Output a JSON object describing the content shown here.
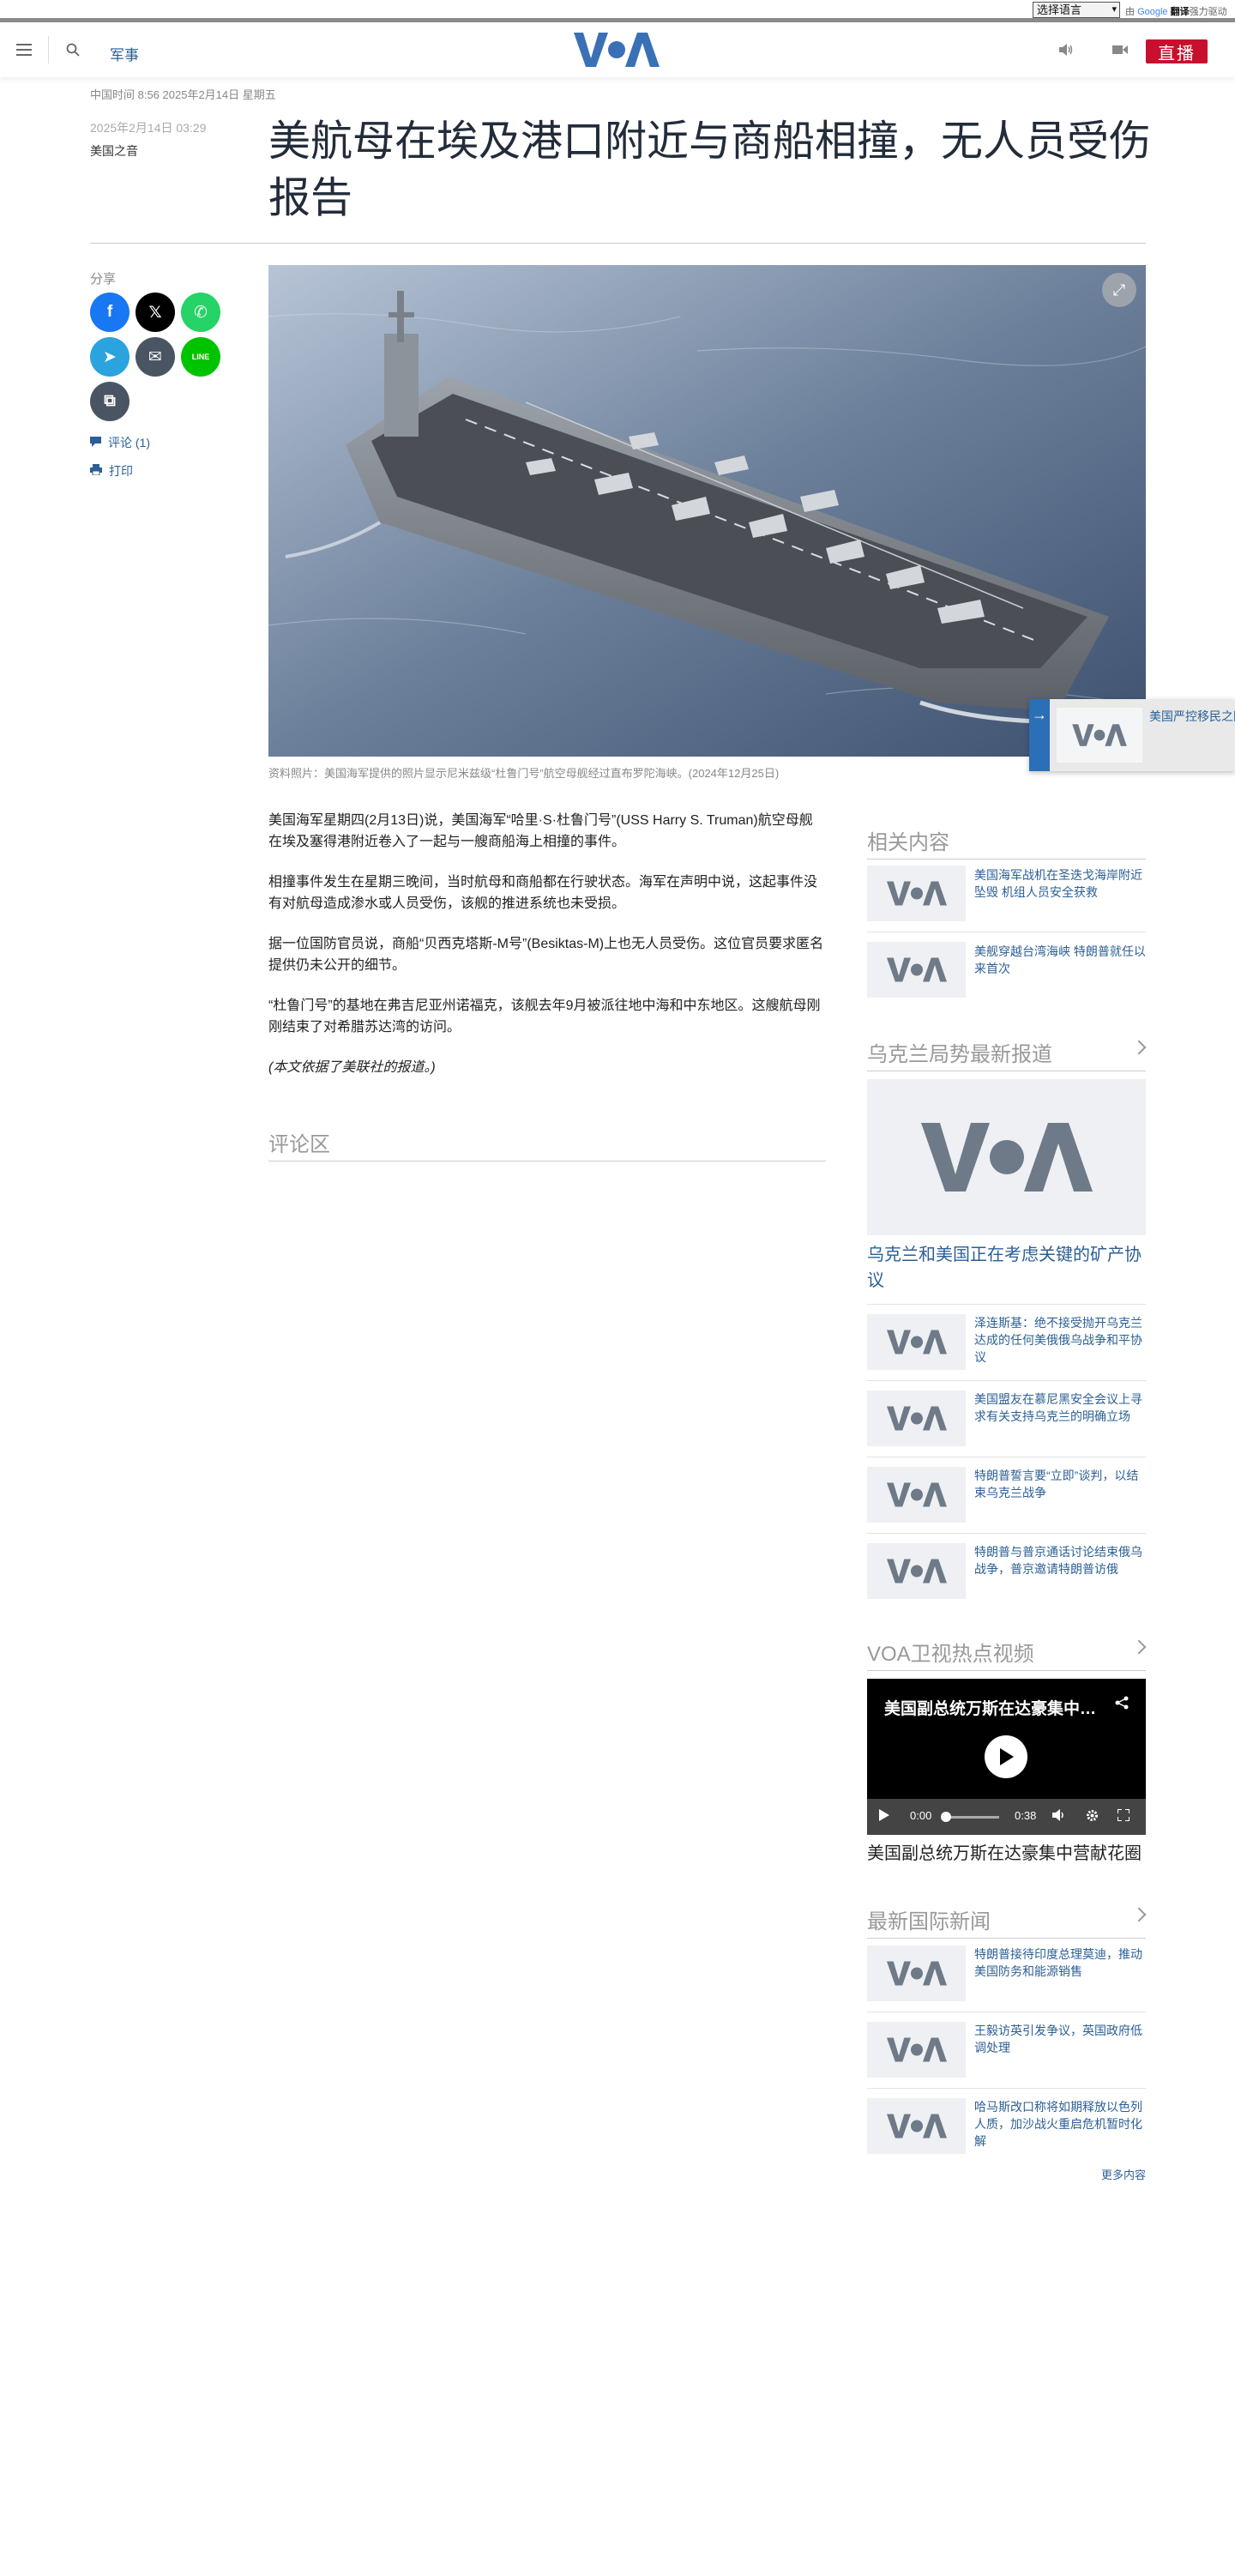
{
  "translate_bar": {
    "select_label": "选择语言",
    "powered_prefix": "由",
    "google": "Google",
    "translate_word": "翻译",
    "powered_suffix": "强力驱动"
  },
  "header": {
    "section": "军事",
    "logo_alt": "VOA",
    "live_label": "直播",
    "icons": [
      "menu-icon",
      "search-icon",
      "audio-icon",
      "video-icon"
    ]
  },
  "article": {
    "dateline": "中国时间 8:56 2025年2月14日 星期五",
    "published": "2025年2月14日 03:29",
    "byline": "美国之音",
    "title": "美航母在埃及港口附近与商船相撞，无人员受伤报告",
    "image_caption": "资料照片：美国海军提供的照片显示尼米兹级“杜鲁门号”航空母舰经过直布罗陀海峡。(2024年12月25日)",
    "paragraphs": [
      "美国海军星期四(2月13日)说，美国海军“哈里·S·杜鲁门号”(USS Harry S. Truman)航空母舰在埃及塞得港附近卷入了一起与一艘商船海上相撞的事件。",
      "相撞事件发生在星期三晚间，当时航母和商船都在行驶状态。海军在声明中说，这起事件没有对航母造成渗水或人员受伤，该舰的推进系统也未受损。",
      "据一位国防官员说，商船“贝西克塔斯-M号”(Besiktas-M)上也无人员受伤。这位官员要求匿名提供仍未公开的细节。",
      "“杜鲁门号”的基地在弗吉尼亚州诺福克，该舰去年9月被派往地中海和中东地区。这艘航母刚刚结束了对希腊苏达湾的访问。"
    ],
    "note": "(本文依据了美联社的报道。)",
    "comments_heading": "评论区"
  },
  "share": {
    "label": "分享",
    "buttons": [
      {
        "name": "facebook-share-button",
        "glyph": "f",
        "color": "#1877f2"
      },
      {
        "name": "x-share-button",
        "glyph": "𝕏",
        "color": "#000000"
      },
      {
        "name": "whatsapp-share-button",
        "glyph": "✆",
        "color": "#25d366"
      },
      {
        "name": "telegram-share-button",
        "glyph": "➤",
        "color": "#2aa3df"
      },
      {
        "name": "email-share-button",
        "glyph": "✉",
        "color": "#4a5563"
      },
      {
        "name": "line-share-button",
        "glyph": "LINE",
        "color": "#00c300"
      },
      {
        "name": "copy-link-button",
        "glyph": "⧉",
        "color": "#4a5563"
      }
    ],
    "comments_link": "评论 (1)",
    "print_link": "打印"
  },
  "sidebar": {
    "related": {
      "heading": "相关内容",
      "items": [
        "美国海军战机在圣迭戈海岸附近坠毁 机组人员安全获救",
        "美舰穿越台湾海峡 特朗普就任以来首次"
      ]
    },
    "ukraine": {
      "heading": "乌克兰局势最新报道",
      "featured": "乌克兰和美国正在考虑关键的矿产协议",
      "items": [
        "泽连斯基：绝不接受抛开乌克兰达成的任何美俄俄乌战争和平协议",
        "美国盟友在慕尼黑安全会议上寻求有关支持乌克兰的明确立场",
        "特朗普誓言要“立即”谈判，以结束乌克兰战争",
        "特朗普与普京通话讨论结束俄乌战争，普京邀请特朗普访俄"
      ]
    },
    "video": {
      "heading": "VOA卫视热点视频",
      "title": "美国副总统万斯在达豪集中营献花圈",
      "time_current": "0:00",
      "time_total": "0:38",
      "caption": "美国副总统万斯在达豪集中营献花圈"
    },
    "world": {
      "heading": "最新国际新闻",
      "items": [
        "特朗普接待印度总理莫迪，推动美国防务和能源销售",
        "王毅访英引发争议，英国政府低调处理",
        "哈马斯改口称将如期释放以色列人质，加沙战火重启危机暂时化解"
      ],
      "more": "更多内容"
    }
  },
  "promo": {
    "text": "美国严控移民之际……中国移民的行动仍……"
  },
  "colors": {
    "brand_blue": "#2b5f95",
    "live_red": "#c8102e",
    "logo_blue": "#3a70b5"
  }
}
